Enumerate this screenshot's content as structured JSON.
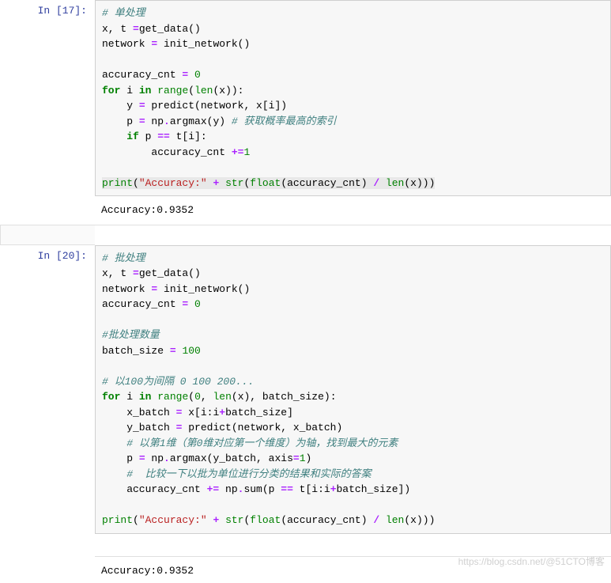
{
  "cells": {
    "cell1": {
      "prompt": "In  [17]:",
      "lines": {
        "c0": "# 单处理",
        "c1a": "x, t ",
        "c1b": "=",
        "c1c": "get_data()",
        "c2a": "network ",
        "c2b": "= ",
        "c2c": "init_network()",
        "c3": "",
        "c4a": "accuracy_cnt ",
        "c4b": "= ",
        "c4c": "0",
        "c5a": "for",
        "c5b": " i ",
        "c5c": "in",
        "c5d": " ",
        "c5e": "range",
        "c5f": "(",
        "c5g": "len",
        "c5h": "(x)):",
        "c6a": "    y ",
        "c6b": "= ",
        "c6c": "predict(network, x[i])",
        "c7a": "    p ",
        "c7b": "= ",
        "c7c": "np",
        "c7d": ".",
        "c7e": "argmax(y) ",
        "c7f": "# 获取概率最高的索引",
        "c8a": "    ",
        "c8b": "if",
        "c8c": " p ",
        "c8d": "== ",
        "c8e": "t[i]:",
        "c9a": "        accuracy_cnt ",
        "c9b": "+=",
        "c9c": "1",
        "c10": "",
        "c11a": "print",
        "c11b": "(",
        "c11c": "\"Accuracy:\"",
        "c11d": " ",
        "c11e": "+ ",
        "c11f": "str",
        "c11g": "(",
        "c11h": "float",
        "c11i": "(accuracy_cnt) ",
        "c11j": "/ ",
        "c11k": "len",
        "c11l": "(x)))"
      },
      "output": "Accuracy:0.9352"
    },
    "cell2": {
      "prompt": "In  [20]:",
      "lines": {
        "c0": "# 批处理",
        "c1a": "x, t ",
        "c1b": "=",
        "c1c": "get_data()",
        "c2a": "network ",
        "c2b": "= ",
        "c2c": "init_network()",
        "c3a": "accuracy_cnt ",
        "c3b": "= ",
        "c3c": "0",
        "c4": "",
        "c5": "#批处理数量",
        "c6a": "batch_size ",
        "c6b": "= ",
        "c6c": "100",
        "c7": "",
        "c8": "# 以100为间隔 0 100 200...",
        "c9a": "for",
        "c9b": " i ",
        "c9c": "in",
        "c9d": " ",
        "c9e": "range",
        "c9f": "(",
        "c9g": "0",
        "c9h": ", ",
        "c9i": "len",
        "c9j": "(x), batch_size):",
        "c10a": "    x_batch ",
        "c10b": "= ",
        "c10c": "x[i:i",
        "c10d": "+",
        "c10e": "batch_size]",
        "c11a": "    y_batch ",
        "c11b": "= ",
        "c11c": "predict(network, x_batch)",
        "c12": "    # 以第1维（第0维对应第一个维度）为轴，找到最大的元素",
        "c13a": "    p ",
        "c13b": "= ",
        "c13c": "np",
        "c13d": ".",
        "c13e": "argmax(y_batch, axis",
        "c13f": "=",
        "c13g": "1",
        "c13h": ")",
        "c14": "    #  比较一下以批为单位进行分类的结果和实际的答案",
        "c15a": "    accuracy_cnt ",
        "c15b": "+= ",
        "c15c": "np",
        "c15d": ".",
        "c15e": "sum(p ",
        "c15f": "== ",
        "c15g": "t[i:i",
        "c15h": "+",
        "c15i": "batch_size])",
        "c16": "",
        "c17a": "print",
        "c17b": "(",
        "c17c": "\"Accuracy:\"",
        "c17d": " ",
        "c17e": "+ ",
        "c17f": "str",
        "c17g": "(",
        "c17h": "float",
        "c17i": "(accuracy_cnt) ",
        "c17j": "/ ",
        "c17k": "len",
        "c17l": "(x)))"
      },
      "output": "Accuracy:0.9352"
    }
  },
  "watermark": "https://blog.csdn.net/@51CTO博客"
}
